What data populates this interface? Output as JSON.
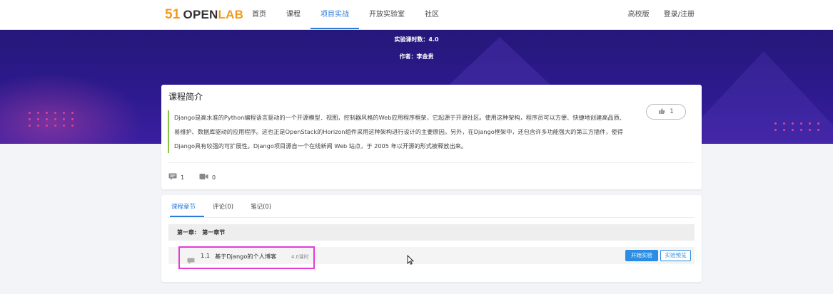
{
  "brand": {
    "num": "51",
    "open": "OPEN",
    "lab": "LAB"
  },
  "nav": {
    "items": [
      "首页",
      "课程",
      "项目实战",
      "开放实验室",
      "社区"
    ],
    "active_index": 2,
    "right": [
      "高校版",
      "登录/注册"
    ]
  },
  "banner": {
    "hours": "实验课时数：4.0",
    "author": "作者：李金贵"
  },
  "intro": {
    "title": "课程简介",
    "text": "Django是高水准的Python编程语言驱动的一个开源模型．视图，控制器风格的Web应用程序框架，它起源于开源社区。使用这种架构，程序员可以方便、快捷地创建高品质、易维护、数据库驱动的应用程序。这也正是OpenStack的Horizon组件采用这种架构进行设计的主要原因。另外，在Django框架中，还包含许多功能强大的第三方插件，使得Django具有较强的可扩展性。Django项目源自一个在线新闻 Web 站点，于 2005 年以开源的形式被释放出来。",
    "likes": "1",
    "comments": "1",
    "videos": "0"
  },
  "tabs": [
    "课程章节",
    "评论(0)",
    "笔记(0)"
  ],
  "chapter": {
    "title": "第一章:　第一章节",
    "lesson": {
      "num": "1.1",
      "name": "基于Django的个人博客",
      "hours": "4.0课时"
    },
    "start_label": "开始实验",
    "preview_label": "实验预览"
  },
  "colors": {
    "accent": "#2f7cd6",
    "brand_orange": "#f39a1a",
    "banner": "#2d1a8e",
    "highlight": "#e53bd8"
  }
}
